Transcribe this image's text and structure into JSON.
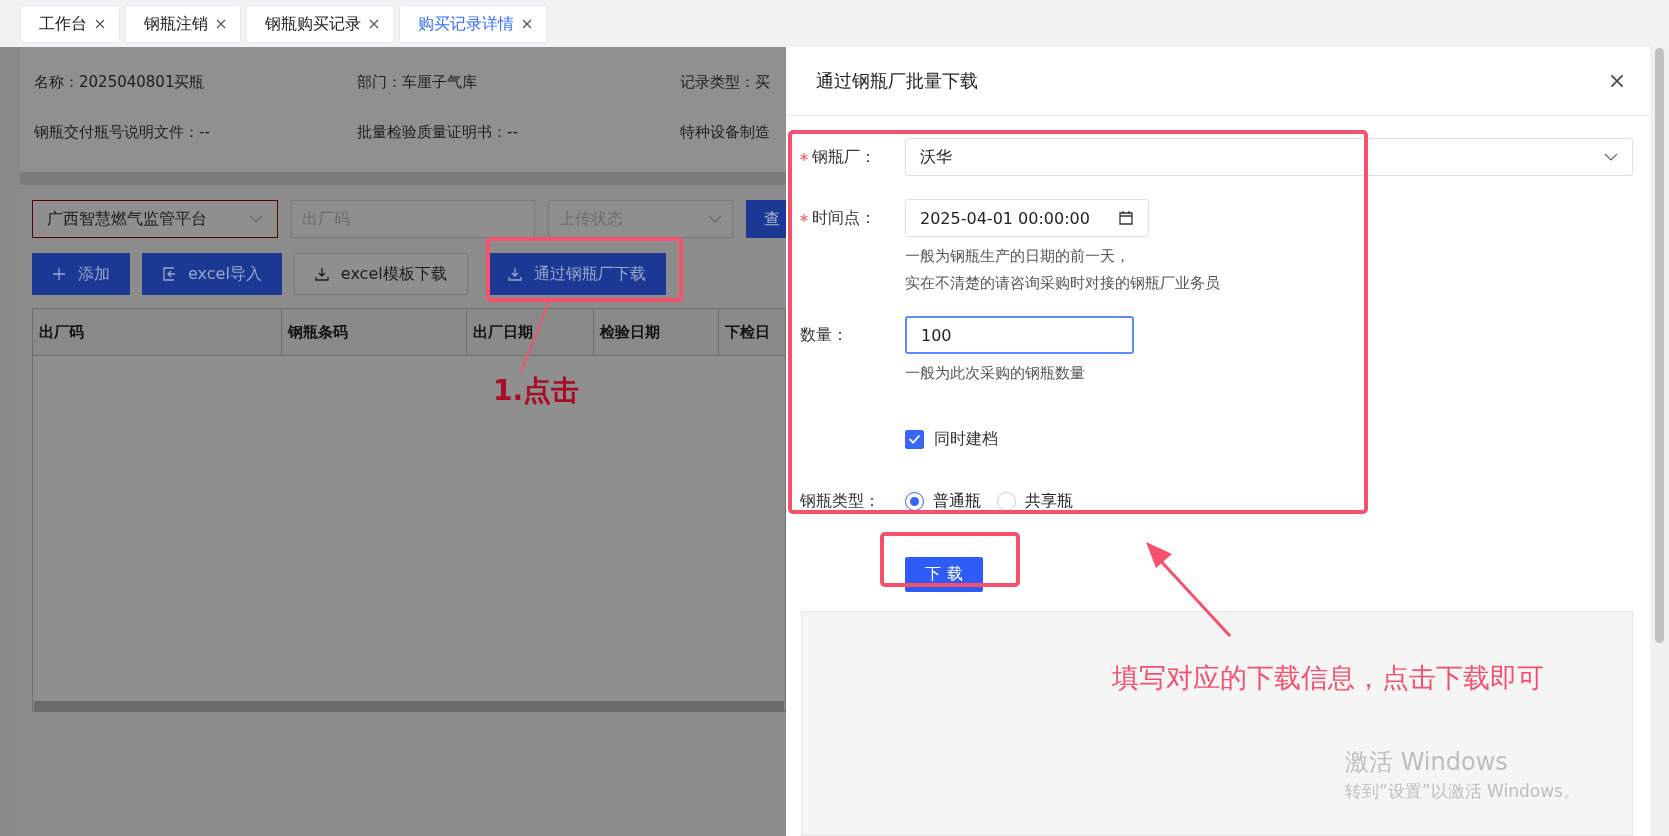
{
  "tabs": [
    {
      "label": "工作台",
      "selected": false
    },
    {
      "label": "钢瓶注销",
      "selected": false
    },
    {
      "label": "钢瓶购买记录",
      "selected": false
    },
    {
      "label": "购买记录详情",
      "selected": true
    }
  ],
  "record_info": [
    [
      "名称：2025040801买瓶",
      "部门：车厘子气库",
      "记录类型：买"
    ],
    [
      "钢瓶交付瓶号说明文件：--",
      "批量检验质量证明书：--",
      "特种设备制造"
    ]
  ],
  "filters": {
    "platform": "广西智慧燃气监管平台",
    "code_placeholder": "出厂码",
    "status_placeholder": "上传状态",
    "query_button": "查"
  },
  "actions": [
    {
      "kind": "primary",
      "label": "添加"
    },
    {
      "kind": "primary",
      "label": "excel导入"
    },
    {
      "kind": "default",
      "label": "excel模板下载"
    },
    {
      "kind": "primary",
      "label": "通过钢瓶厂下载"
    }
  ],
  "table": {
    "columns": [
      "出厂码",
      "钢瓶条码",
      "出厂日期",
      "检验日期",
      "下检日"
    ]
  },
  "drawer": {
    "title": "通过钢瓶厂批量下载",
    "fields": [
      {
        "kind": "select",
        "label": "钢瓶厂：",
        "required": true,
        "value": "沃华"
      },
      {
        "kind": "date",
        "label": "时间点：",
        "required": true,
        "value": "2025-04-01 00:00:00",
        "help": [
          "一般为钢瓶生产的日期的前一天，",
          "实在不清楚的请咨询采购时对接的钢瓶厂业务员"
        ]
      },
      {
        "kind": "input",
        "label": "数量：",
        "required": false,
        "value": "100",
        "focused": true,
        "help": [
          "一般为此次采购的钢瓶数量"
        ]
      },
      {
        "kind": "checkbox",
        "label": "同时建档",
        "checked": true
      },
      {
        "kind": "radio",
        "label": "钢瓶类型：",
        "options": [
          {
            "label": "普通瓶",
            "selected": true
          },
          {
            "label": "共享瓶",
            "selected": false
          }
        ]
      }
    ],
    "submit": "下 载"
  },
  "annotations": {
    "step": "1.点击",
    "note": "填写对应的下载信息，点击下载即可"
  },
  "os_notice": {
    "title": "激活 Windows",
    "subtitle": "转到“设置”以激活 Windows。"
  }
}
